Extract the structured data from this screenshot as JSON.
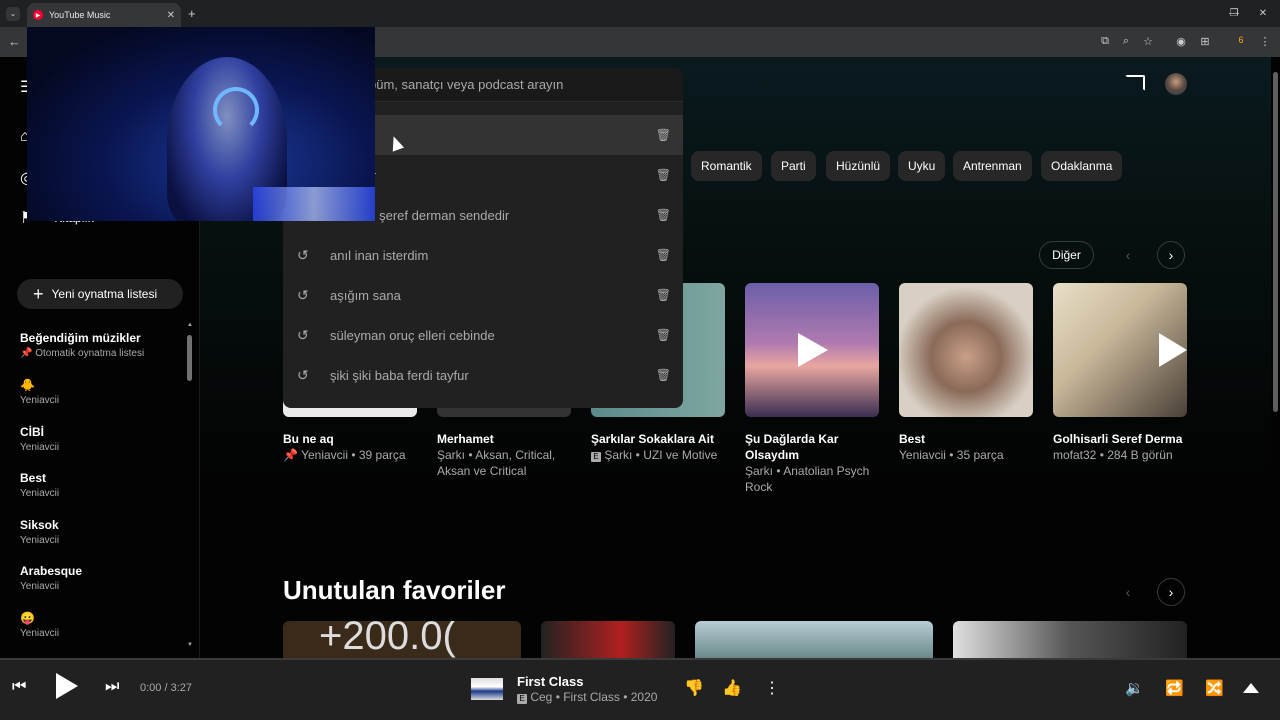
{
  "browser": {
    "tab_title": "YouTube Music",
    "controls": [
      "minimize-icon",
      "maximize-icon",
      "close-icon"
    ],
    "badge": "6"
  },
  "search": {
    "placeholder": "Şarkı, albüm, sanatçı veya podcast arayın",
    "visible_placeholder": "büm, sanatçı veya podcast arayın",
    "suggestions": [
      {
        "visible": "",
        "text": ""
      },
      {
        "visible": "lr",
        "text": ""
      },
      {
        "visible": "lı şeref derman sendedir",
        "text": ""
      },
      {
        "visible": "anıl inan isterdim",
        "text": "anıl inan isterdim"
      },
      {
        "visible": "aşığım sana",
        "text": "aşığım sana"
      },
      {
        "visible": "süleyman oruç elleri cebinde",
        "text": "süleyman oruç elleri cebinde"
      },
      {
        "visible": "şiki şiki baba ferdi tayfur",
        "text": "şiki şiki baba ferdi tayfur"
      }
    ]
  },
  "sidebar": {
    "nav_partial": "Kitaplık",
    "new_playlist": "Yeni oynatma listesi",
    "playlists": [
      {
        "title": "Beğendiğim müzikler",
        "sub": "Otomatik oynatma listesi"
      },
      {
        "title": "🐥",
        "sub": "Yeniavcii"
      },
      {
        "title": "CİBİ",
        "sub": "Yeniavcii"
      },
      {
        "title": "Best",
        "sub": "Yeniavcii"
      },
      {
        "title": "Siksok",
        "sub": "Yeniavcii"
      },
      {
        "title": "Arabesque",
        "sub": "Yeniavcii"
      },
      {
        "title": "😛",
        "sub": "Yeniavcii"
      }
    ]
  },
  "chips": [
    "Romantik",
    "Parti",
    "Hüzünlü",
    "Uyku",
    "Antrenman",
    "Odaklanma"
  ],
  "shelf": {
    "more": "Diğer",
    "cards": [
      {
        "title": "Bu ne aq",
        "sub": "Yeniavcii • 39 parça"
      },
      {
        "title": "Merhamet",
        "sub": "Şarkı • Aksan, Critical, Aksan ve Critical"
      },
      {
        "title": "Şarkılar Sokaklara Ait",
        "sub": "Şarkı • UZI ve Motive"
      },
      {
        "title": "Şu Dağlarda Kar Olsaydım",
        "sub": "Şarkı • Anatolian Psych Rock"
      },
      {
        "title": "Best",
        "sub": "Yeniavcii • 35 parça"
      },
      {
        "title": "Golhisarli Seref Derma",
        "sub": "mofat32 • 284 B görün"
      }
    ]
  },
  "section2": {
    "title": "Unutulan favoriler",
    "thumb_text": "+200.0("
  },
  "player": {
    "time": "0:00 / 3:27",
    "title": "First Class",
    "sub": "Ceg • First Class • 2020",
    "progress": 0
  }
}
